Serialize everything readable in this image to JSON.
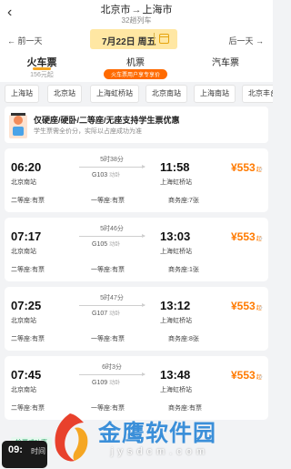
{
  "header": {
    "from": "北京市",
    "arrow": "→",
    "to": "上海市",
    "train_count": "32趟列车"
  },
  "datebar": {
    "prev": "← 前一天",
    "date": "7月22日 周五",
    "next": "后一天 →"
  },
  "modes": {
    "train": "火车票",
    "train_sub": "156元起",
    "plane": "机票",
    "plane_promo": "火车票用户享专享价",
    "bus": "汽车票"
  },
  "stations": [
    "上海站",
    "北京站",
    "上海虹桥站",
    "北京南站",
    "上海南站",
    "北京丰台站"
  ],
  "banner": {
    "title": "仅硬座/硬卧/二等座/无座支持学生票优惠",
    "subtitle": "学生票需全价分，实际以占座成功为准"
  },
  "trains": [
    {
      "dep_time": "06:20",
      "dep_station": "北京南站",
      "duration": "5时38分",
      "train_no": "G103",
      "tag": "动卧",
      "arr_time": "11:58",
      "arr_station": "上海虹桥站",
      "price": "¥553",
      "price_suffix": "起",
      "seats": [
        "二等座:有票",
        "一等座:有票",
        "商务座:7张"
      ]
    },
    {
      "dep_time": "07:17",
      "dep_station": "北京南站",
      "duration": "5时46分",
      "train_no": "G105",
      "tag": "动卧",
      "arr_time": "13:03",
      "arr_station": "上海虹桥站",
      "price": "¥553",
      "price_suffix": "起",
      "seats": [
        "二等座:有票",
        "一等座:有票",
        "商务座:1张"
      ]
    },
    {
      "dep_time": "07:25",
      "dep_station": "北京南站",
      "duration": "5时47分",
      "train_no": "G107",
      "tag": "动卧",
      "arr_time": "13:12",
      "arr_station": "上海虹桥站",
      "price": "¥553",
      "price_suffix": "起",
      "seats": [
        "二等座:有票",
        "一等座:有票",
        "商务座:8张"
      ]
    },
    {
      "dep_time": "07:45",
      "dep_station": "北京南站",
      "duration": "6时3分",
      "train_no": "G109",
      "tag": "动卧",
      "arr_time": "13:48",
      "arr_station": "上海虹桥站",
      "price": "¥553",
      "price_suffix": "起",
      "seats": [
        "二等座:有票",
        "一等座:有票",
        "商务座:有票"
      ]
    }
  ],
  "cta": "抢票成功率",
  "float_time": {
    "time": "09:",
    "label": "时间"
  },
  "watermark": {
    "title": "金鹰软件园",
    "url": "jysdcm.com"
  }
}
